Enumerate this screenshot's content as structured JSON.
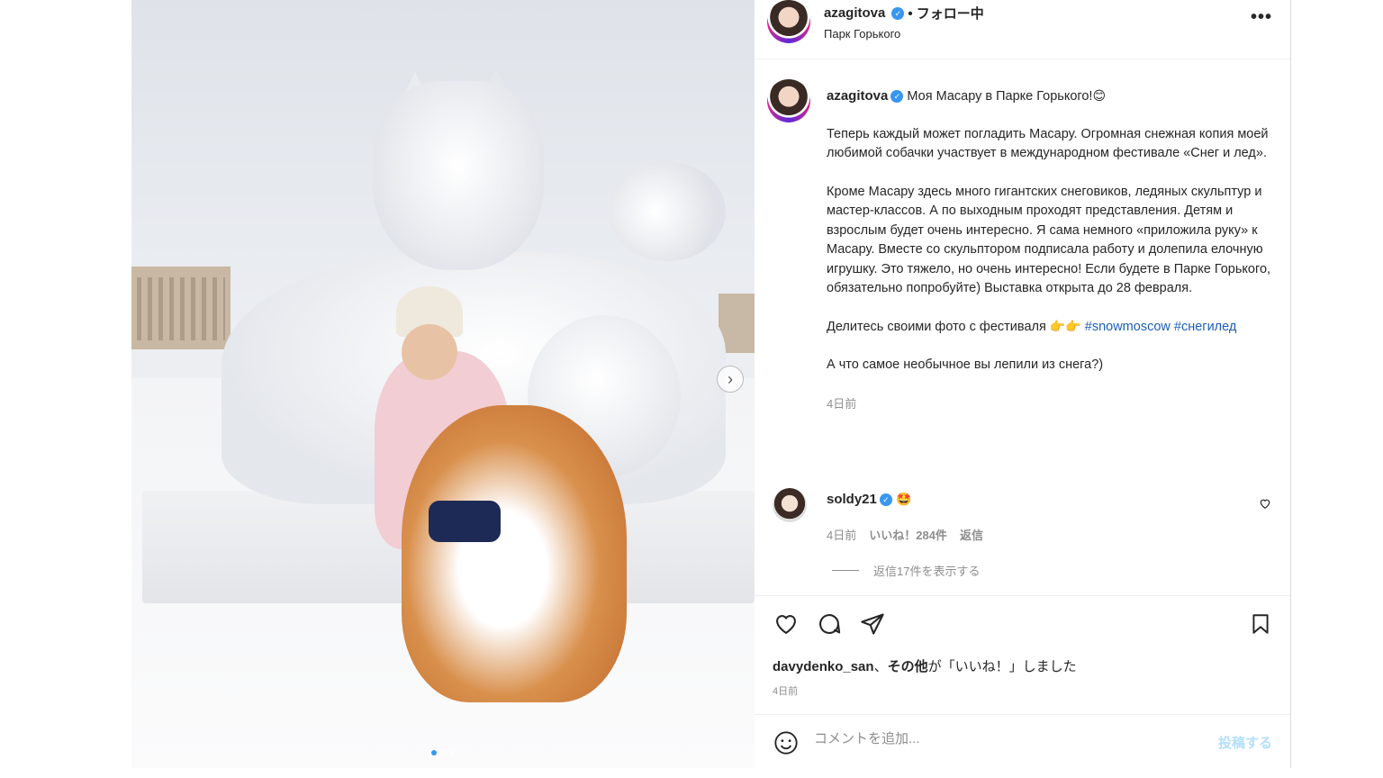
{
  "post": {
    "author": "azagitova",
    "follow_status": "• フォロー中",
    "location": "Парк Горького",
    "more": "•••"
  },
  "caption": {
    "username": "azagitova",
    "first_line": "Моя Масару в Парке Горького!",
    "first_emoji": "😊",
    "para1": "Теперь каждый может погладить Масару. Огромная снежная копия моей любимой собачки участвует в международном фестивале «Снег и лед».",
    "para2": "Кроме Масару здесь много гигантских снеговиков, ледяных скульптур и мастер-классов. А по выходным проходят представления. Детям и взрослым будет очень интересно. Я сама немного «приложила руку» к Масару. Вместе со скульптором подписала работу и долепила елочную игрушку. Это тяжело, но очень интересно! Если будете в Парке Горького, обязательно попробуйте) Выставка открыта до 28 февраля.",
    "para3_text": "Делитесь своими фото с фестиваля",
    "para3_emoji": "👉👉",
    "hashtag1": "#snowmoscow",
    "hashtag2": "#снегилед",
    "para4": "А что самое необычное вы лепили из снега?)",
    "time": "4日前"
  },
  "reply": {
    "username": "soldy21",
    "emoji": "🤩",
    "time": "4日前",
    "likes": "いいね！284件",
    "reply_label": "返信",
    "view_replies": "返信17件を表示する"
  },
  "actions": {
    "liked_by_user": "davydenko_san",
    "liked_by_rest": "、",
    "liked_by_others": "その他",
    "liked_by_suffix": "が「いいね！」しました",
    "time": "4日前"
  },
  "comment_box": {
    "placeholder": "コメントを追加...",
    "post_label": "投稿する"
  },
  "carousel": {
    "next_icon": "›"
  },
  "colors": {
    "verified": "#3897f0",
    "link": "#1c5fb8",
    "post_disabled": "#b2dffc"
  }
}
